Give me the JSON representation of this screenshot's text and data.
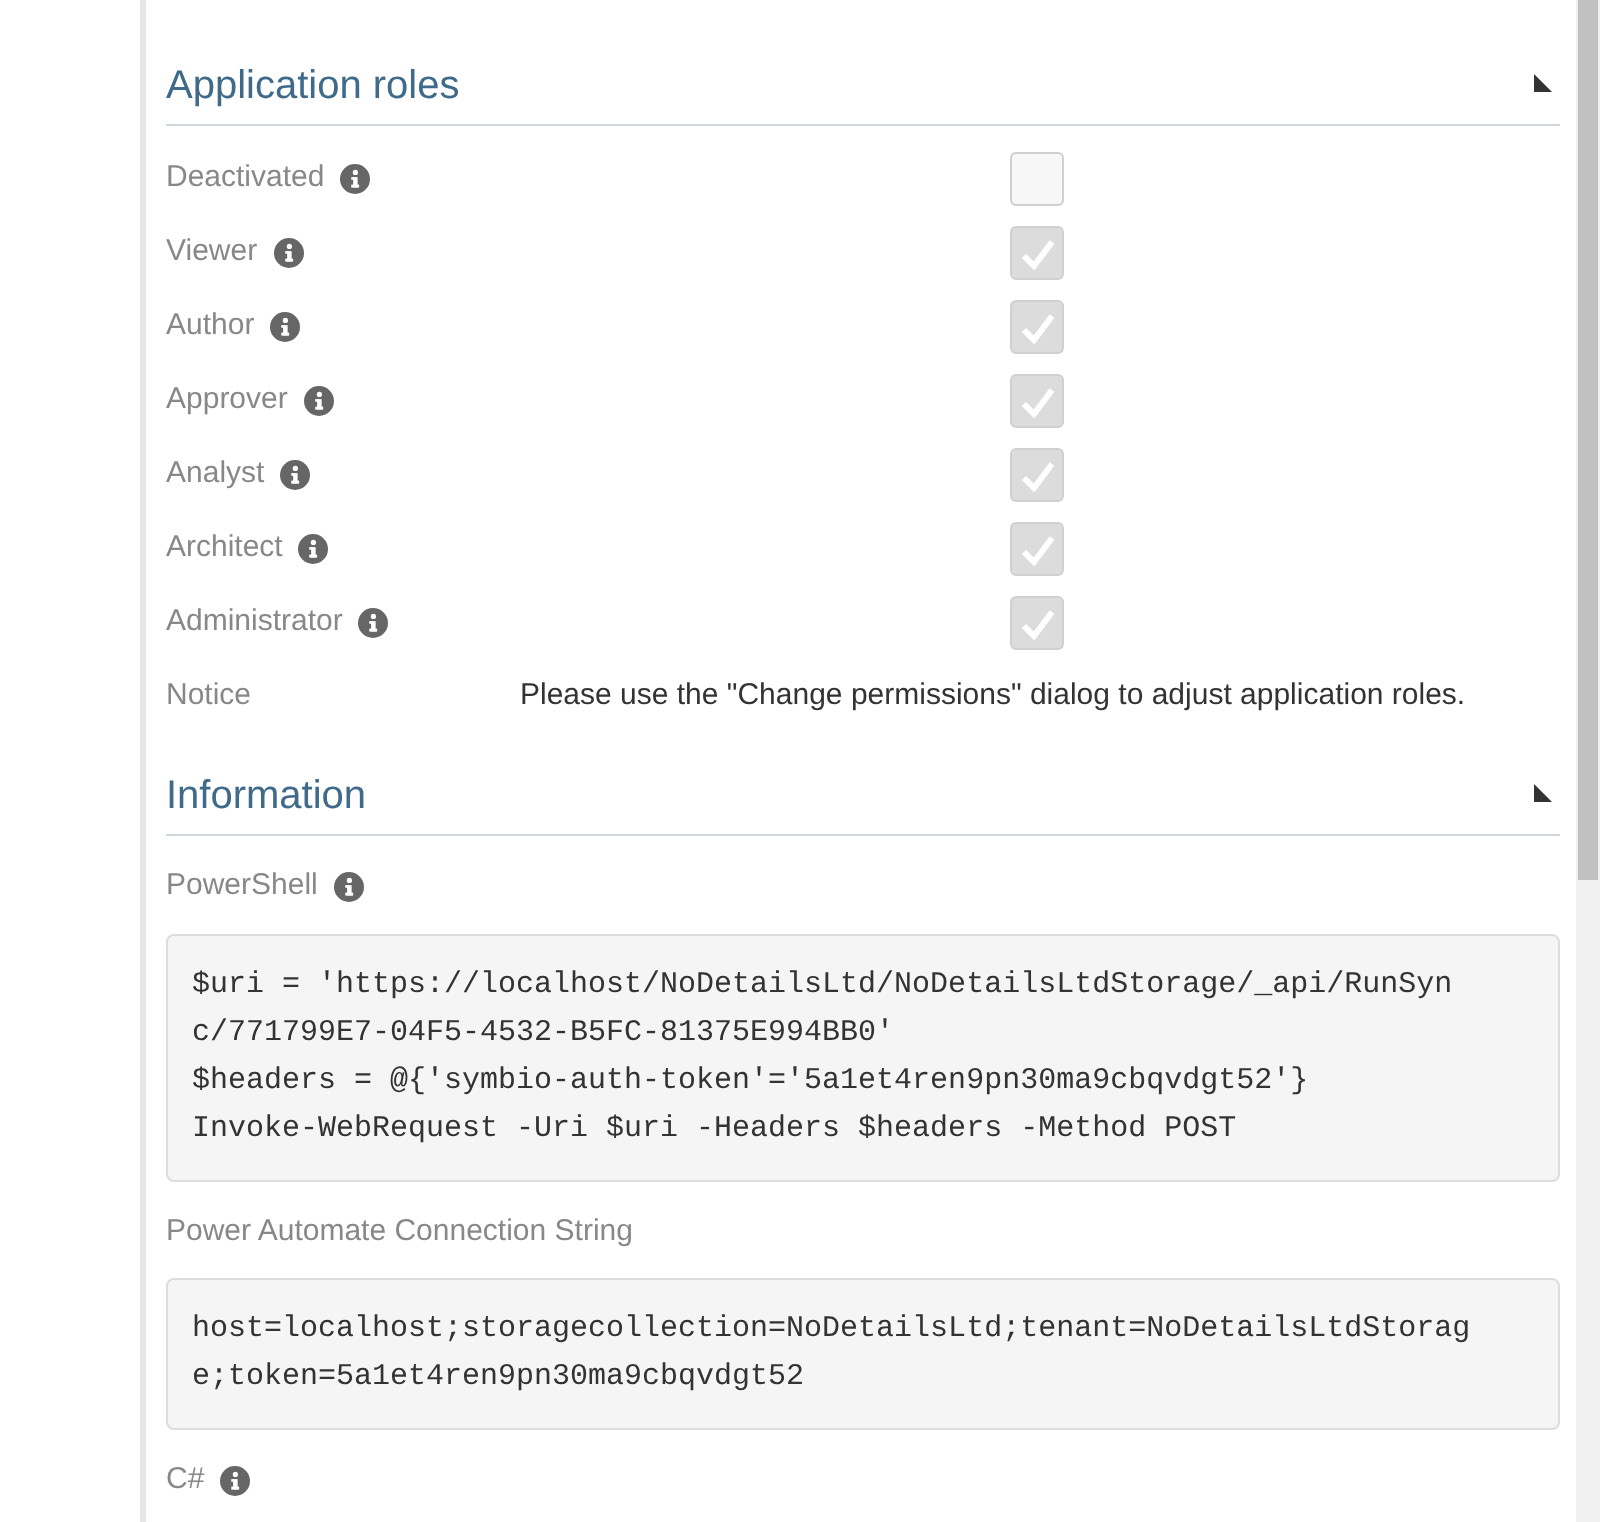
{
  "sections": [
    {
      "kind": "roles",
      "title": "Application roles",
      "roles": [
        {
          "label": "Deactivated",
          "checked": false,
          "disabled": false
        },
        {
          "label": "Viewer",
          "checked": true,
          "disabled": true
        },
        {
          "label": "Author",
          "checked": true,
          "disabled": true
        },
        {
          "label": "Approver",
          "checked": true,
          "disabled": true
        },
        {
          "label": "Analyst",
          "checked": true,
          "disabled": true
        },
        {
          "label": "Architect",
          "checked": true,
          "disabled": true
        },
        {
          "label": "Administrator",
          "checked": true,
          "disabled": true
        }
      ],
      "notice": {
        "label": "Notice",
        "text": "Please use the \"Change permissions\" dialog to adjust application roles."
      }
    },
    {
      "kind": "info",
      "title": "Information",
      "fields": [
        {
          "label": "PowerShell",
          "info": true,
          "lines": [
            "$uri = 'https://localhost/NoDetailsLtd/NoDetailsLtdStorage/_api/RunSyn",
            "c/771799E7-04F5-4532-B5FC-81375E994BB0'",
            "$headers = @{'symbio-auth-token'='5a1et4ren9pn30ma9cbqvdgt52'}",
            "Invoke-WebRequest -Uri $uri -Headers $headers -Method POST"
          ]
        },
        {
          "label": "Power Automate Connection String",
          "info": false,
          "lines": [
            "host=localhost;storagecollection=NoDetailsLtd;tenant=NoDetailsLtdStorag",
            "e;token=5a1et4ren9pn30ma9cbqvdgt52"
          ]
        },
        {
          "label": "C#",
          "info": true
        }
      ]
    }
  ]
}
